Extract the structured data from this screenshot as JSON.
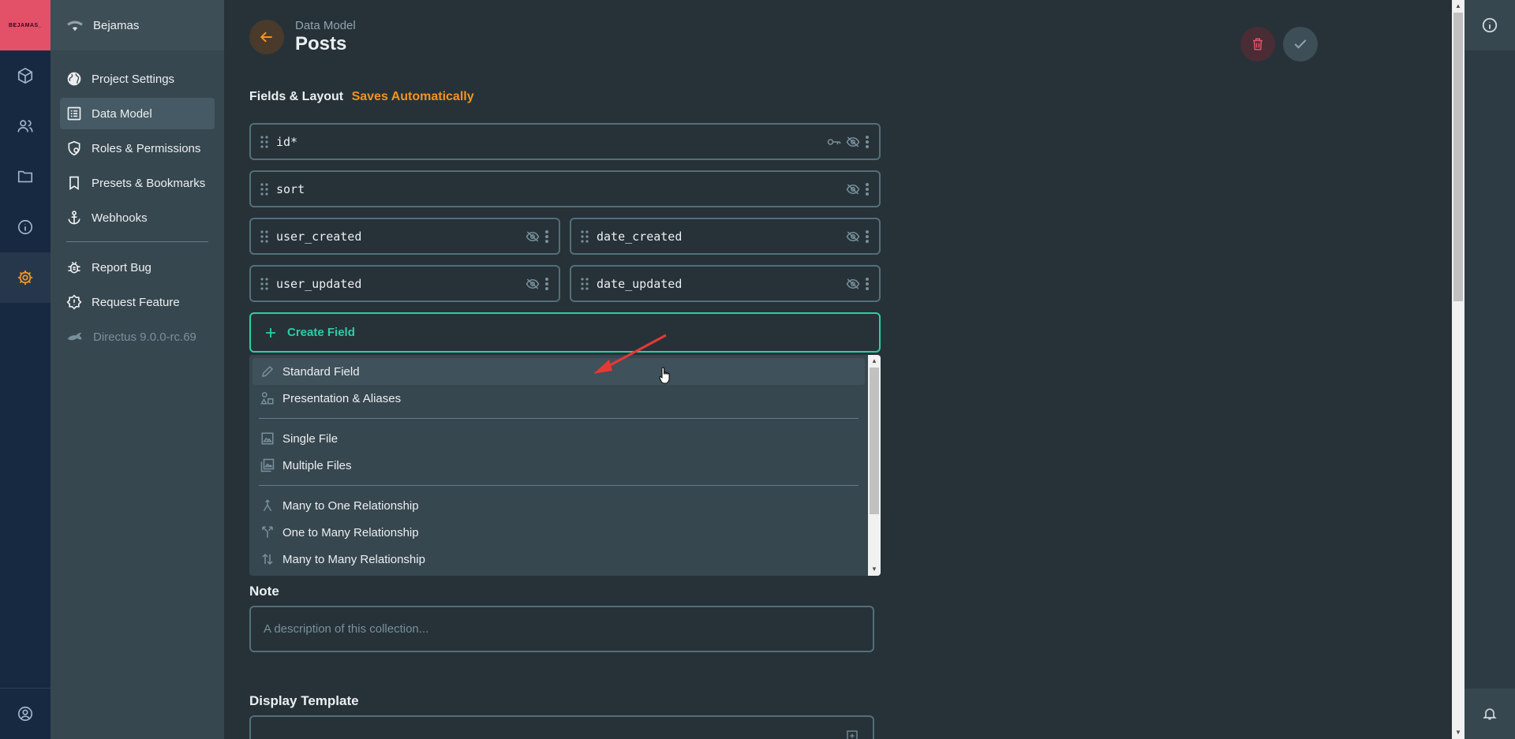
{
  "brand": {
    "text": "BEJAMAS_",
    "color": "#e35169"
  },
  "module_bar": {
    "items": [
      {
        "icon": "box-icon"
      },
      {
        "icon": "users-icon"
      },
      {
        "icon": "folder-icon"
      },
      {
        "icon": "info-icon"
      },
      {
        "icon": "gear-icon",
        "active": true
      }
    ],
    "bottom_icon": "user-circle-icon"
  },
  "project": {
    "name": "Bejamas"
  },
  "nav": {
    "items": [
      {
        "label": "Project Settings",
        "icon": "globe-icon"
      },
      {
        "label": "Data Model",
        "icon": "list-icon",
        "active": true
      },
      {
        "label": "Roles & Permissions",
        "icon": "shield-icon"
      },
      {
        "label": "Presets & Bookmarks",
        "icon": "bookmark-icon"
      },
      {
        "label": "Webhooks",
        "icon": "anchor-icon"
      }
    ],
    "secondary": [
      {
        "label": "Report Bug",
        "icon": "bug-icon"
      },
      {
        "label": "Request Feature",
        "icon": "alert-icon"
      },
      {
        "label": "Directus 9.0.0-rc.69",
        "icon": "rabbit-icon"
      }
    ]
  },
  "header": {
    "eyebrow": "Data Model",
    "title": "Posts"
  },
  "fields_section": {
    "label": "Fields & Layout",
    "status": "Saves Automatically"
  },
  "fields": {
    "id": "id*",
    "sort": "sort",
    "user_created": "user_created",
    "date_created": "date_created",
    "user_updated": "user_updated",
    "date_updated": "date_updated"
  },
  "create_field": {
    "label": "Create Field"
  },
  "create_menu": {
    "standard": "Standard Field",
    "presentation": "Presentation & Aliases",
    "single_file": "Single File",
    "multiple_files": "Multiple Files",
    "m2o": "Many to One Relationship",
    "o2m": "One to Many Relationship",
    "m2m": "Many to Many Relationship"
  },
  "note": {
    "label": "Note",
    "placeholder": "A description of this collection..."
  },
  "display_template": {
    "label": "Display Template"
  },
  "colors": {
    "accent": "#f7931e",
    "success": "#2ecda7",
    "danger": "#e35169"
  }
}
